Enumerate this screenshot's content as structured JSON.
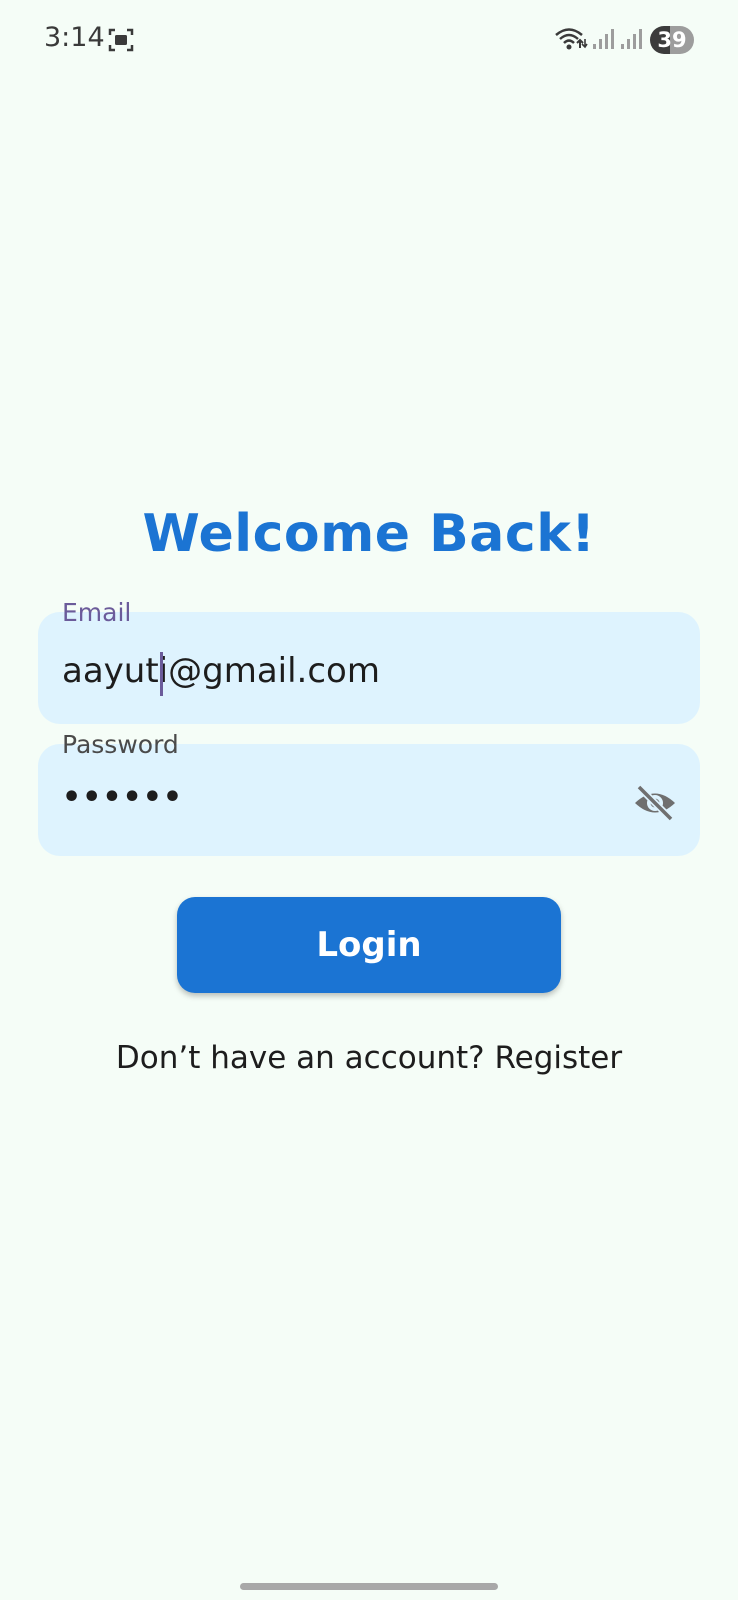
{
  "status_bar": {
    "time": "3:14",
    "battery": "39"
  },
  "icons": {
    "screenshot": "screenshot-icon",
    "wifi": "wifi-icon",
    "signal": "signal-icon",
    "visibility_off": "eye-off-icon"
  },
  "login": {
    "title": "Welcome Back!",
    "email_label": "Email",
    "email_value": "aayuti@gmail.com",
    "password_label": "Password",
    "password_value": "••••••",
    "login_button": "Login",
    "register_prompt": "Don’t have an account?",
    "register_link": "Register"
  },
  "colors": {
    "background": "#f5fdf7",
    "primary": "#1b74d3",
    "field_background": "#def3fe",
    "label_focused": "#6b5b9a"
  }
}
